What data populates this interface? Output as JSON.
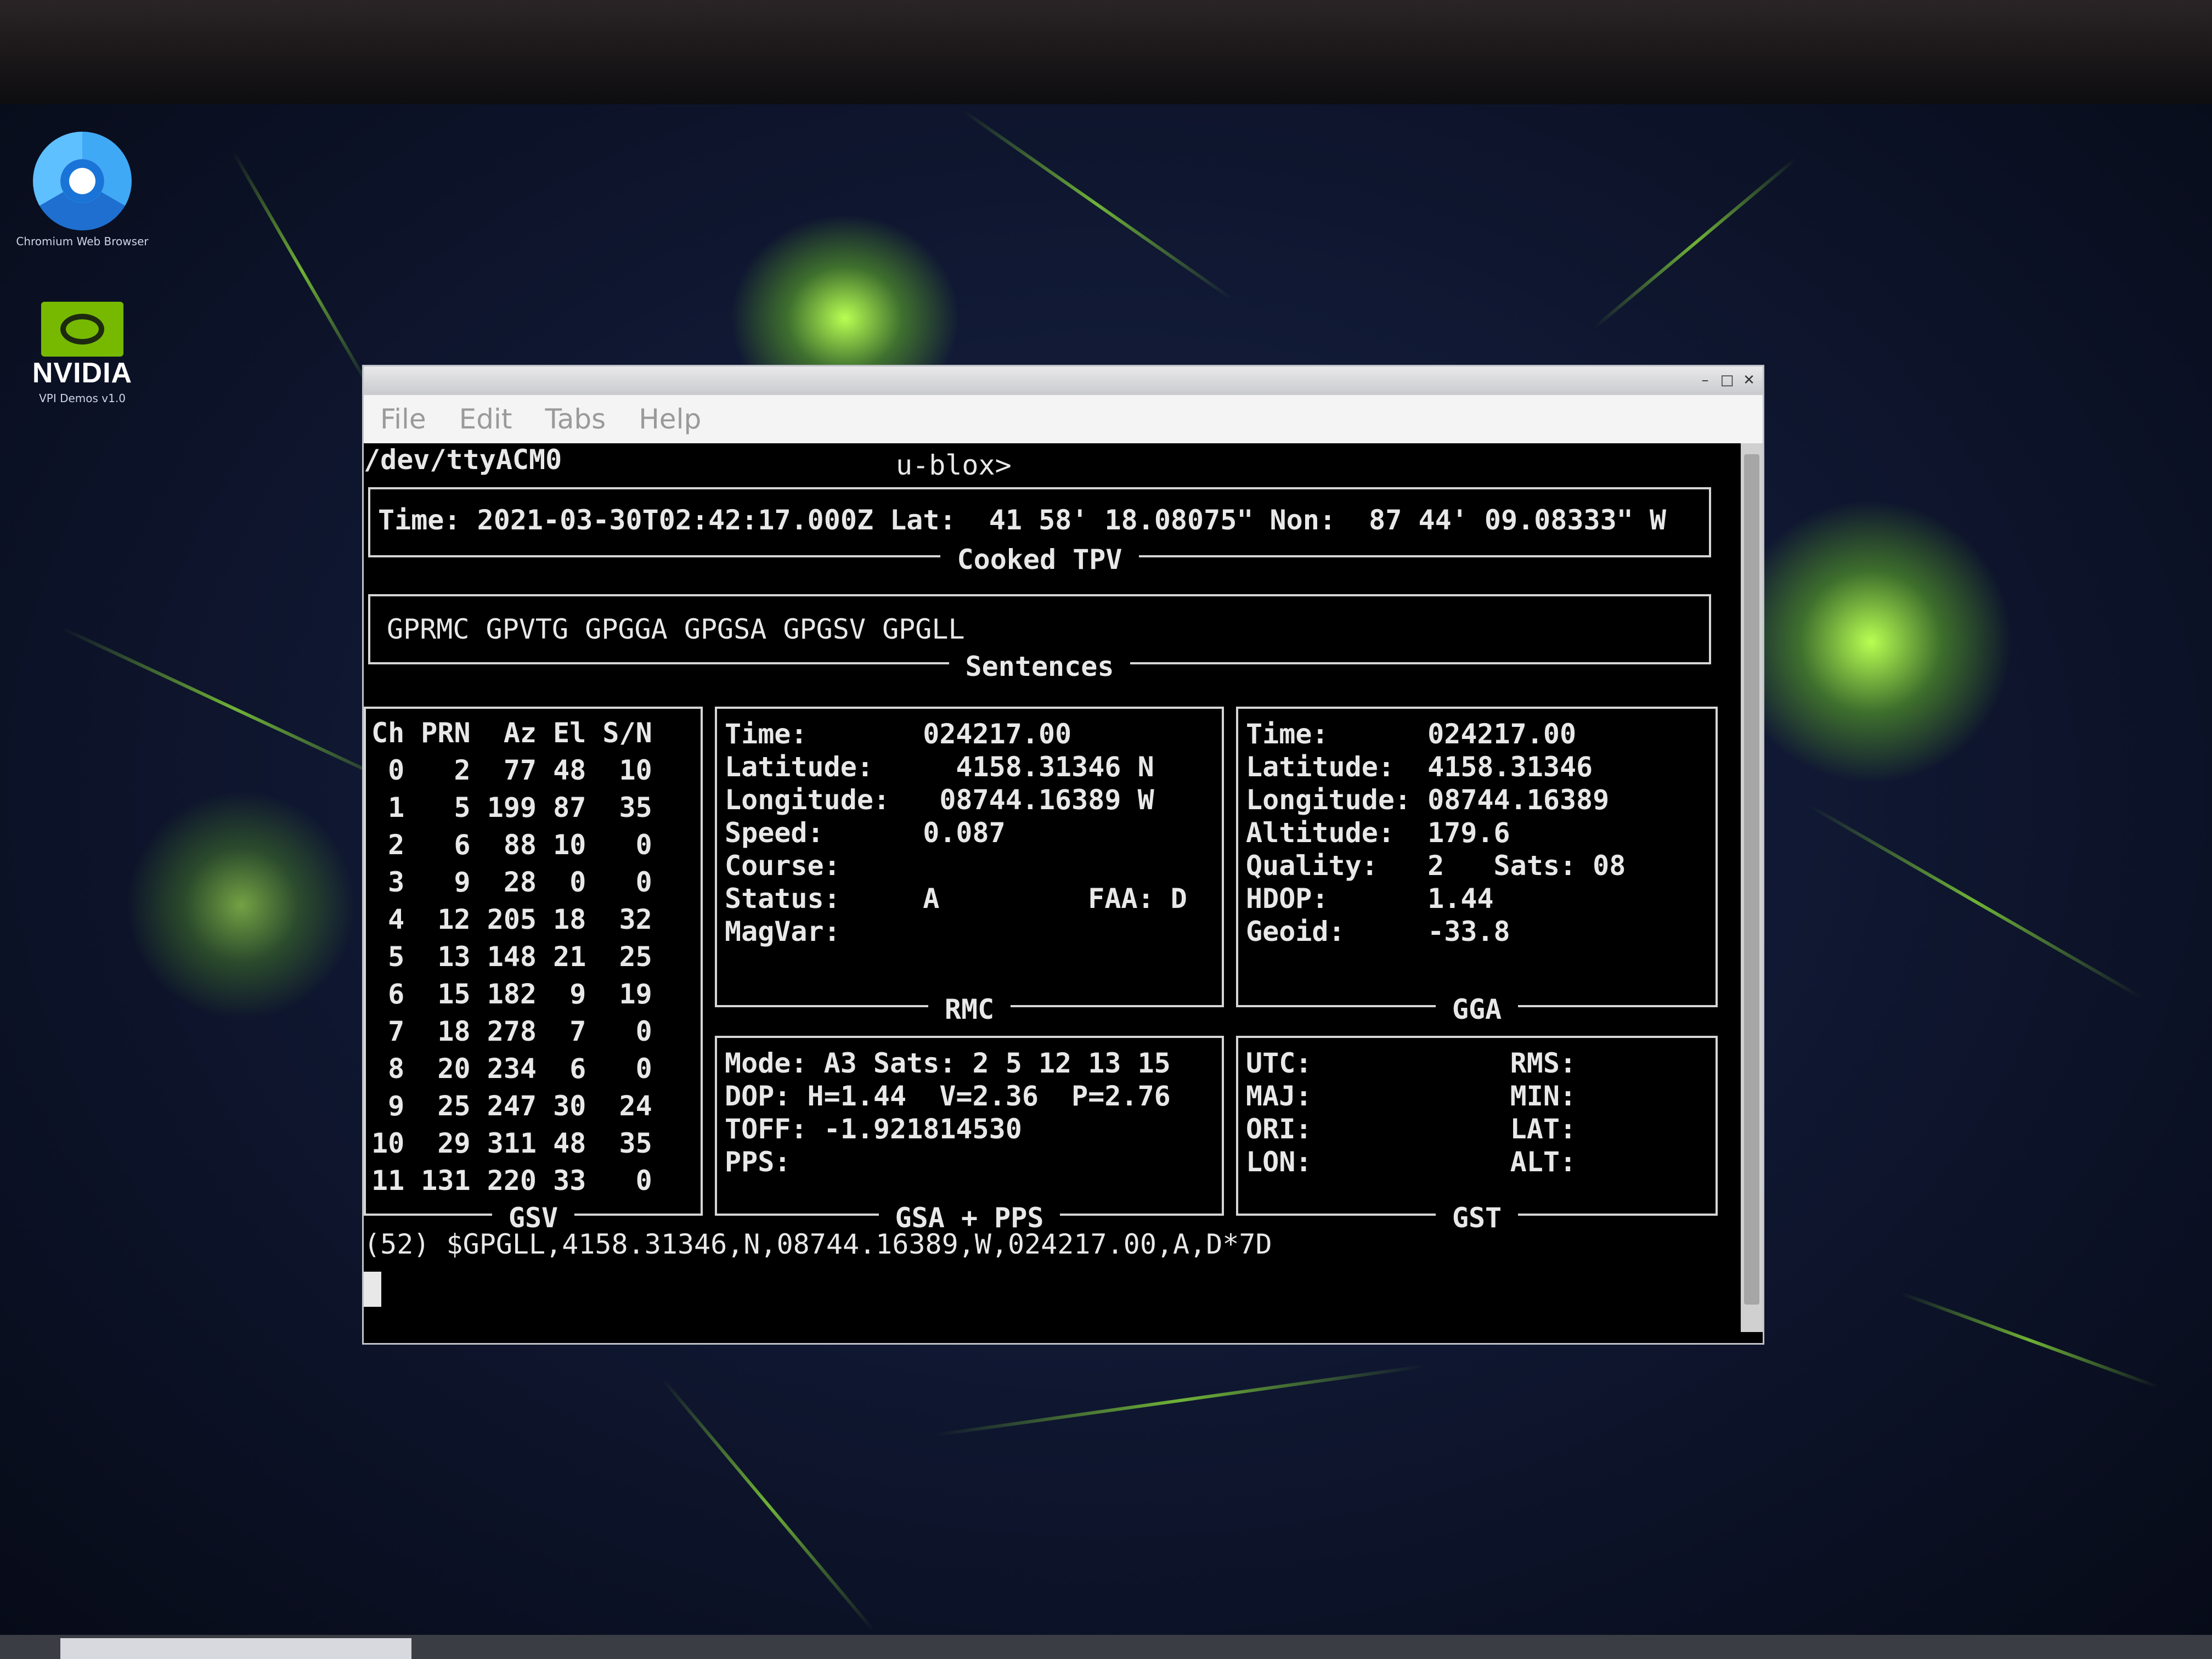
{
  "desktop": {
    "icons": [
      {
        "label": "Chromium Web Browser",
        "icon": "chromium-icon"
      },
      {
        "label": "VPI Demos v1.0",
        "icon": "nvidia-icon",
        "brand": "NVIDIA"
      }
    ],
    "colors": {
      "wallpaper": "#0f1630",
      "accent": "#8fe63a"
    }
  },
  "window": {
    "title": "",
    "menu": [
      "File",
      "Edit",
      "Tabs",
      "Help"
    ],
    "controls": [
      "minimize-icon",
      "maximize-icon",
      "close-icon"
    ]
  },
  "terminal": {
    "device": "/dev/ttyACM0",
    "prompt": "u-blox>",
    "tpv": {
      "label": "Cooked TPV",
      "line": "Time: 2021-03-30T02:42:17.000Z Lat:  41 58' 18.08075\" Non:  87 44' 09.08333\" W"
    },
    "sentences": {
      "label": "Sentences",
      "list": "GPRMC GPVTG GPGGA GPGSA GPGSV GPGLL"
    },
    "gsv": {
      "label": "GSV",
      "header": "Ch PRN  Az El S/N",
      "rows": [
        " 0   2  77 48  10",
        " 1   5 199 87  35",
        " 2   6  88 10   0",
        " 3   9  28  0   0",
        " 4  12 205 18  32",
        " 5  13 148 21  25",
        " 6  15 182  9  19",
        " 7  18 278  7   0",
        " 8  20 234  6   0",
        " 9  25 247 30  24",
        "10  29 311 48  35",
        "11 131 220 33   0"
      ]
    },
    "rmc": {
      "label": "RMC",
      "lines": [
        "Time:       024217.00",
        "Latitude:     4158.31346 N",
        "Longitude:   08744.16389 W",
        "Speed:      0.087",
        "Course:",
        "Status:     A         FAA: D",
        "MagVar:"
      ]
    },
    "gga": {
      "label": "GGA",
      "lines": [
        "Time:      024217.00",
        "Latitude:  4158.31346",
        "Longitude: 08744.16389",
        "Altitude:  179.6",
        "Quality:   2   Sats: 08",
        "HDOP:      1.44",
        "Geoid:     -33.8"
      ]
    },
    "gsa": {
      "label": "GSA + PPS",
      "lines": [
        "Mode: A3 Sats: 2 5 12 13 15",
        "DOP: H=1.44  V=2.36  P=2.76",
        "TOFF: -1.921814530",
        "PPS:"
      ]
    },
    "gst": {
      "label": "GST",
      "lines": [
        "UTC:            RMS:",
        "MAJ:            MIN:",
        "ORI:            LAT:",
        "LON:            ALT:"
      ]
    },
    "raw": "(52) $GPGLL,4158.31346,N,08744.16389,W,024217.00,A,D*7D"
  }
}
